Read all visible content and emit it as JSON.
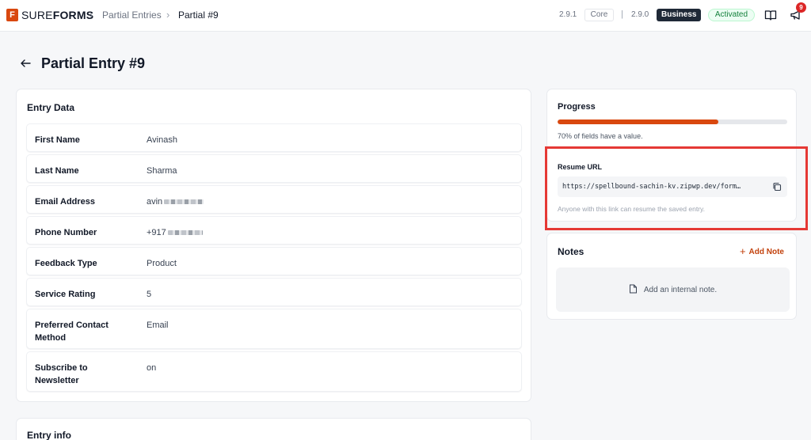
{
  "header": {
    "logo_letter": "F",
    "logo_sure": "SURE",
    "logo_forms": "FORMS",
    "breadcrumbs": [
      {
        "label": "Partial Entries"
      },
      {
        "label": "Partial #9"
      }
    ],
    "core_version": "2.9.1",
    "core_label": "Core",
    "pro_version": "2.9.0",
    "plan_label": "Business",
    "status_label": "Activated",
    "notification_count": "9",
    "brand_color": "#d9480f"
  },
  "page": {
    "title": "Partial Entry #9"
  },
  "entry_data": {
    "title": "Entry Data",
    "rows": [
      {
        "label": "First Name",
        "value": "Avinash"
      },
      {
        "label": "Last Name",
        "value": "Sharma"
      },
      {
        "label": "Email Address",
        "value": "avin"
      },
      {
        "label": "Phone Number",
        "value": "+917"
      },
      {
        "label": "Feedback Type",
        "value": "Product"
      },
      {
        "label": "Service Rating",
        "value": "5"
      },
      {
        "label": "Preferred Contact Method",
        "value": "Email"
      },
      {
        "label": "Subscribe to Newsletter",
        "value": "on"
      }
    ]
  },
  "entry_info": {
    "title": "Entry info"
  },
  "progress": {
    "title": "Progress",
    "percent": 70,
    "text": "70% of fields have a value.",
    "resume_label": "Resume URL",
    "resume_url": "https://spellbound-sachin-kv.zipwp.dev/form…",
    "resume_help": "Anyone with this link can resume the saved entry."
  },
  "notes": {
    "title": "Notes",
    "add_label": "Add Note",
    "empty_text": "Add an internal note."
  }
}
